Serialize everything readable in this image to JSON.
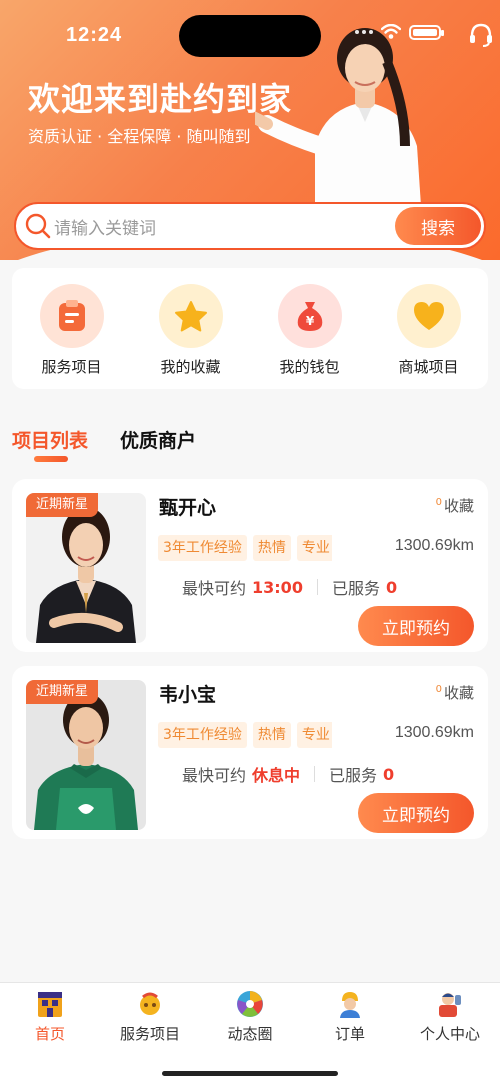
{
  "status_bar": {
    "time": "12:24"
  },
  "hero": {
    "title": "欢迎来到赴约到家",
    "subtitle": "资质认证 · 全程保障 · 随叫随到"
  },
  "search": {
    "placeholder": "请输入关键词",
    "button_label": "搜索"
  },
  "quick_actions": [
    {
      "label": "服务项目",
      "icon": "clipboard-icon",
      "color": "#f46a3a"
    },
    {
      "label": "我的收藏",
      "icon": "star-icon",
      "color": "#f7b21c"
    },
    {
      "label": "我的钱包",
      "icon": "money-bag-icon",
      "color": "#ef4a3b"
    },
    {
      "label": "商城项目",
      "icon": "heart-icon",
      "color": "#f7b21c"
    }
  ],
  "tabs": [
    {
      "label": "项目列表",
      "active": true
    },
    {
      "label": "优质商户",
      "active": false
    }
  ],
  "providers": [
    {
      "badge": "近期新星",
      "name": "甄开心",
      "favorite_count": "0",
      "favorite_label": "收藏",
      "tags": [
        "3年工作经验",
        "热情",
        "专业"
      ],
      "distance": "1300.69km",
      "earliest_label": "最快可约",
      "earliest_value": "13:00",
      "served_label": "已服务",
      "served_count": "0",
      "book_label": "立即预约"
    },
    {
      "badge": "近期新星",
      "name": "韦小宝",
      "favorite_count": "0",
      "favorite_label": "收藏",
      "tags": [
        "3年工作经验",
        "热情",
        "专业"
      ],
      "distance": "1300.69km",
      "earliest_label": "最快可约",
      "earliest_value": "休息中",
      "served_label": "已服务",
      "served_count": "0",
      "book_label": "立即预约"
    }
  ],
  "tabbar": [
    {
      "label": "首页",
      "icon": "home-icon",
      "active": true
    },
    {
      "label": "服务项目",
      "icon": "service-icon",
      "active": false
    },
    {
      "label": "动态圈",
      "icon": "aperture-icon",
      "active": false
    },
    {
      "label": "订单",
      "icon": "worker-icon",
      "active": false
    },
    {
      "label": "个人中心",
      "icon": "profile-icon",
      "active": false
    }
  ],
  "colors": {
    "accent": "#f4572b",
    "hero_start": "#f8a66a",
    "hero_end": "#fb6a2c"
  }
}
